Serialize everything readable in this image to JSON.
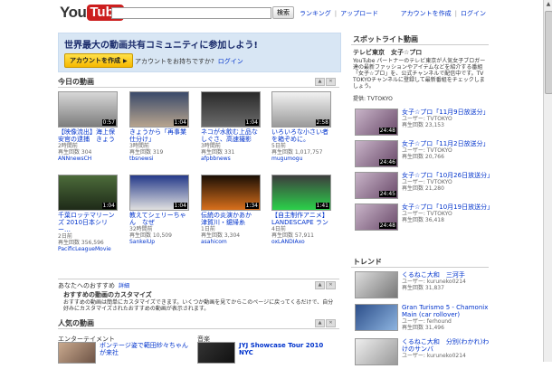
{
  "header": {
    "logo_you": "You",
    "logo_tube": "Tube",
    "search_button": "検索",
    "nav": [
      "ランキング",
      "アップロード"
    ],
    "user": [
      "アカウントを作成",
      "ログイン"
    ]
  },
  "banner": {
    "title": "世界最大の動画共有コミュニティに参加しよう!",
    "join_button": "アカウントを作成",
    "have_account": "アカウントをお持ちですか?",
    "login": "ログイン"
  },
  "today": {
    "title": "今日の動画",
    "videos": [
      {
        "title": "【映像流出】海上保安官の逮捕　きょう",
        "time": "2時間前",
        "views": "再生回数 304",
        "user": "ANNnewsCH",
        "duration": "0:57"
      },
      {
        "title": "きょうから「再事業仕分け」",
        "time": "3時間前",
        "views": "再生回数 319",
        "user": "tbsnewsi",
        "duration": "1:04"
      },
      {
        "title": "ネコが水飲む上品なしぐさ、高速撮影",
        "time": "3時間前",
        "views": "再生回数 331",
        "user": "afpbbnews",
        "duration": "1:04"
      },
      {
        "title": "いろいろな小さい者を箱ぞめに。",
        "time": "5日前",
        "views": "再生回数 1,017,757",
        "user": "mugumogu",
        "duration": "2:58"
      },
      {
        "title": "千葉ロッテマリーンズ 2010日本シリー…",
        "time": "2日前",
        "views": "再生回数 356,596",
        "user": "PacificLeagueMovie",
        "duration": "1:04"
      },
      {
        "title": "教えてシェリーちゃん　なぜ",
        "time": "32時間前",
        "views": "再生回数 10,509",
        "user": "SankeiUp",
        "duration": "1:04"
      },
      {
        "title": "伝統の炎演かあか　津賀川・鋸帰糸",
        "time": "1日前",
        "views": "再生回数 3,304",
        "user": "asahicom",
        "duration": "1:34"
      },
      {
        "title": "【自主制作アニメ】LANDESCAPE ラン",
        "time": "4日前",
        "views": "再生回数 57,911",
        "user": "oxLANDIAxo",
        "duration": "1:41"
      }
    ]
  },
  "recommend": {
    "title": "あなたへのおすすめ",
    "detail_link": "詳細",
    "bold": "おすすめの動画のカスタマイズ",
    "body": "おすすめの動画は簡単にカスタマイズできます。いくつか動画を見てからこのページに戻ってくるだけで、自分好みにカスタマイズされたおすすめの動画が表示されます。"
  },
  "popular": {
    "title": "人気の動画",
    "categories": [
      "エンターテイメント",
      "音楽"
    ],
    "items": [
      {
        "title": "ボンテージ姿で範田紗々ちゃん が来社"
      },
      {
        "title": "JYJ Showcase Tour 2010 NYC"
      }
    ]
  },
  "spotlight": {
    "title": "スポットライト動画",
    "subtitle": "テレビ東京　女子☆プロ",
    "description": "YouTube パートナーのテレビ東京が人気女子ブロガー達の最新ファッションやアイテムなどを紹介する番組「女子☆プロ」を、公式チャンネルで配信中です。TV TOKYOチャンネルに登録して最新番組をチェックしましょう。",
    "provider": "提供: TVTOKYO",
    "items": [
      {
        "title": "女子☆プロ「11月9日放送分」",
        "user": "ユーザー: TVTOKYO",
        "views": "再生回数 23,153",
        "duration": "24:48"
      },
      {
        "title": "女子☆プロ「11月2日放送分」",
        "user": "ユーザー: TVTOKYO",
        "views": "再生回数 20,766",
        "duration": "24:46"
      },
      {
        "title": "女子☆プロ「10月26日放送分」",
        "user": "ユーザー: TVTOKYO",
        "views": "再生回数 21,280",
        "duration": "24:45"
      },
      {
        "title": "女子☆プロ「10月19日放送分」",
        "user": "ユーザー: TVTOKYO",
        "views": "再生回数 36,418",
        "duration": "24:48"
      }
    ]
  },
  "trend": {
    "title": "トレンド",
    "items": [
      {
        "title": "くるねこ大和　三河手",
        "user": "ユーザー: kuruneko0214",
        "views": "再生回数 31,837"
      },
      {
        "title": "Gran Turismo 5 - Chamonix Main (car rollover)",
        "user": "ユーザー: ferhound",
        "views": "再生回数 31,496"
      },
      {
        "title": "くるねこ大和　分別(わかれ)わけのサンバ",
        "user": "ユーザー: kuruneko0214",
        "views": ""
      }
    ]
  }
}
